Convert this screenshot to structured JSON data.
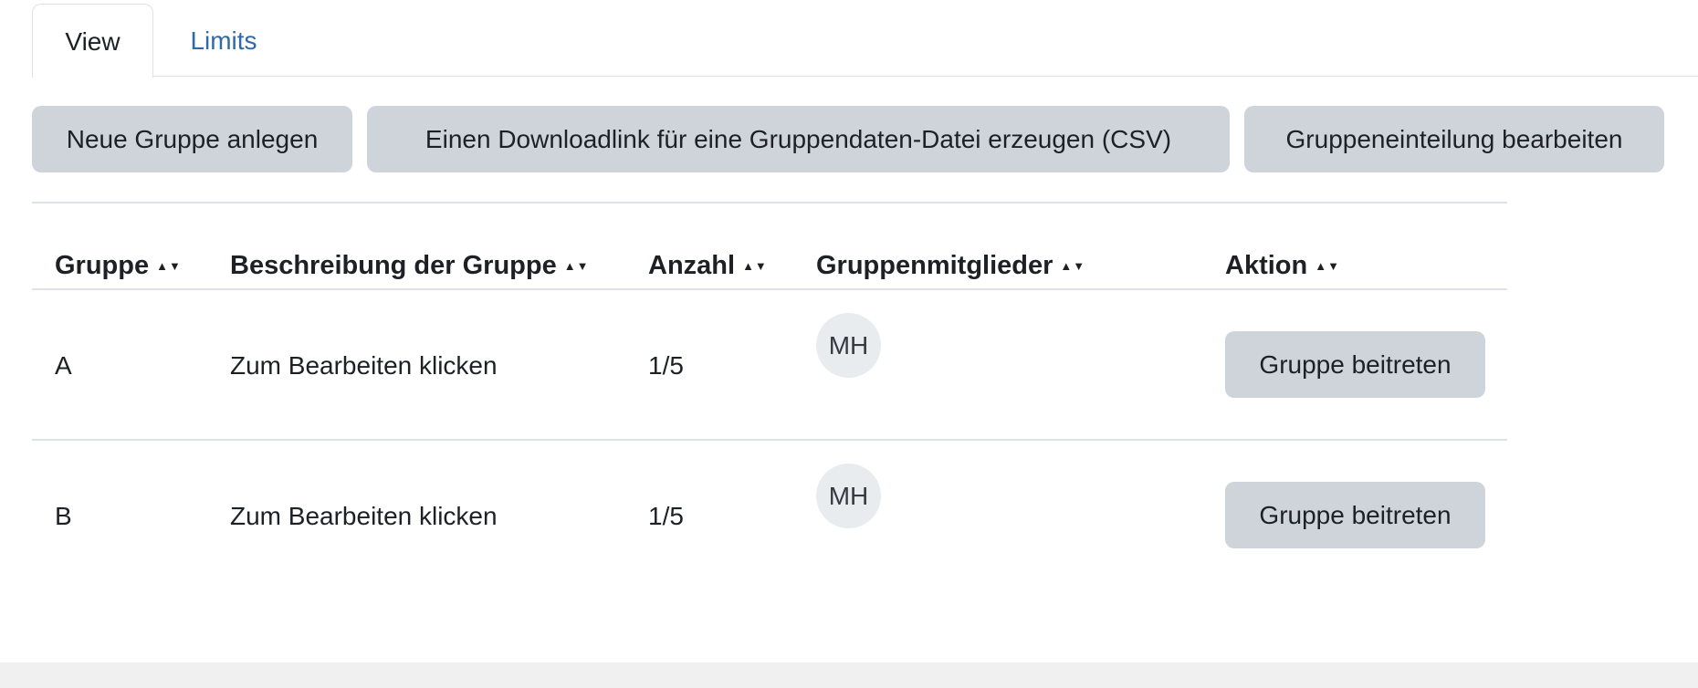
{
  "tabs": [
    {
      "label": "View",
      "active": true
    },
    {
      "label": "Limits",
      "active": false
    }
  ],
  "actions": {
    "new_group": "Neue Gruppe anlegen",
    "download_link": "Einen Downloadlink für eine Gruppendaten-Datei erzeugen (CSV)",
    "edit_grouping": "Gruppeneinteilung bearbeiten"
  },
  "table": {
    "headers": [
      "Gruppe",
      "Beschreibung der Gruppe",
      "Anzahl",
      "Gruppenmitglieder",
      "Aktion"
    ],
    "rows": [
      {
        "group": "A",
        "description": "Zum Bearbeiten klicken",
        "count": "1/5",
        "members": [
          "MH"
        ],
        "action": "Gruppe beitreten"
      },
      {
        "group": "B",
        "description": "Zum Bearbeiten klicken",
        "count": "1/5",
        "members": [
          "MH"
        ],
        "action": "Gruppe beitreten"
      }
    ]
  },
  "colors": {
    "link": "#2f6aa6",
    "button_bg": "#ced4da",
    "avatar_bg": "#e9ecef",
    "border": "#dee2e6"
  },
  "icons": {
    "sort": "sort-icon"
  }
}
